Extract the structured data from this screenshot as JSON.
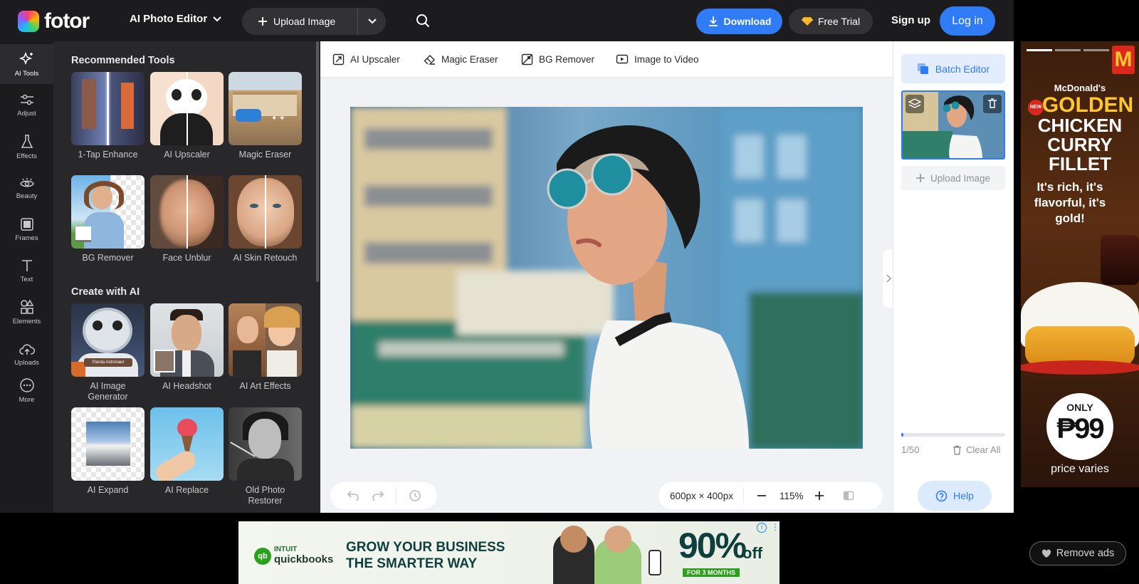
{
  "header": {
    "logo_text": "fotor",
    "editor_menu": "AI Photo Editor",
    "upload_label": "Upload Image",
    "download_label": "Download",
    "trial_label": "Free Trial",
    "signup_label": "Sign up",
    "login_label": "Log in"
  },
  "rail": [
    {
      "label": "AI Tools",
      "icon": "sparkle-icon"
    },
    {
      "label": "Adjust",
      "icon": "sliders-icon"
    },
    {
      "label": "Effects",
      "icon": "flask-icon"
    },
    {
      "label": "Beauty",
      "icon": "eye-icon"
    },
    {
      "label": "Frames",
      "icon": "frame-icon"
    },
    {
      "label": "Text",
      "icon": "text-icon"
    },
    {
      "label": "Elements",
      "icon": "shapes-icon"
    },
    {
      "label": "Uploads",
      "icon": "cloud-upload-icon"
    },
    {
      "label": "More",
      "icon": "more-icon"
    }
  ],
  "tools_panel": {
    "recommended_title": "Recommended Tools",
    "recommended": [
      {
        "label": "1-Tap Enhance"
      },
      {
        "label": "AI Upscaler"
      },
      {
        "label": "Magic Eraser"
      },
      {
        "label": "BG Remover"
      },
      {
        "label": "Face Unblur"
      },
      {
        "label": "AI Skin Retouch"
      }
    ],
    "create_title": "Create with AI",
    "create": [
      {
        "label": "AI Image Generator",
        "badge": "Panda Astronaut"
      },
      {
        "label": "AI Headshot"
      },
      {
        "label": "AI Art Effects"
      },
      {
        "label": "AI Expand"
      },
      {
        "label": "AI Replace"
      },
      {
        "label": "Old Photo Restorer"
      }
    ]
  },
  "toolbar_tabs": [
    {
      "label": "AI Upscaler",
      "icon": "upscale-icon"
    },
    {
      "label": "Magic Eraser",
      "icon": "eraser-icon"
    },
    {
      "label": "BG Remover",
      "icon": "bg-remove-icon"
    },
    {
      "label": "Image to Video",
      "icon": "video-icon"
    }
  ],
  "canvas": {
    "size": "600px × 400px",
    "zoom": "115%"
  },
  "side_panel": {
    "batch_label": "Batch Editor",
    "upload_label": "Upload Image",
    "count": "1/50",
    "count_fraction": 0.02,
    "clear_label": "Clear All",
    "help_label": "Help"
  },
  "ads": {
    "right": {
      "brand": "McDonald's",
      "badge": "NEW",
      "headline_1": "GOLDEN",
      "headline_2": "CHICKEN",
      "headline_3": "CURRY",
      "headline_4": "FILLET",
      "tagline": "It's rich, it's flavorful, it's gold!",
      "price_prefix": "ONLY",
      "price": "₱99",
      "price_note": "price varies"
    },
    "banner": {
      "brand_1": "INTUIT",
      "brand_2": "quickbooks",
      "headline_1": "GROW YOUR BUSINESS",
      "headline_2": "THE SMARTER WAY",
      "offer": "90%",
      "offer_suffix": "off",
      "offer_note": "FOR 3 MONTHS"
    },
    "remove_label": "Remove ads"
  },
  "colors": {
    "accent": "#2f7cf6",
    "panel": "#28282b",
    "topbar": "#1c1c1f"
  }
}
